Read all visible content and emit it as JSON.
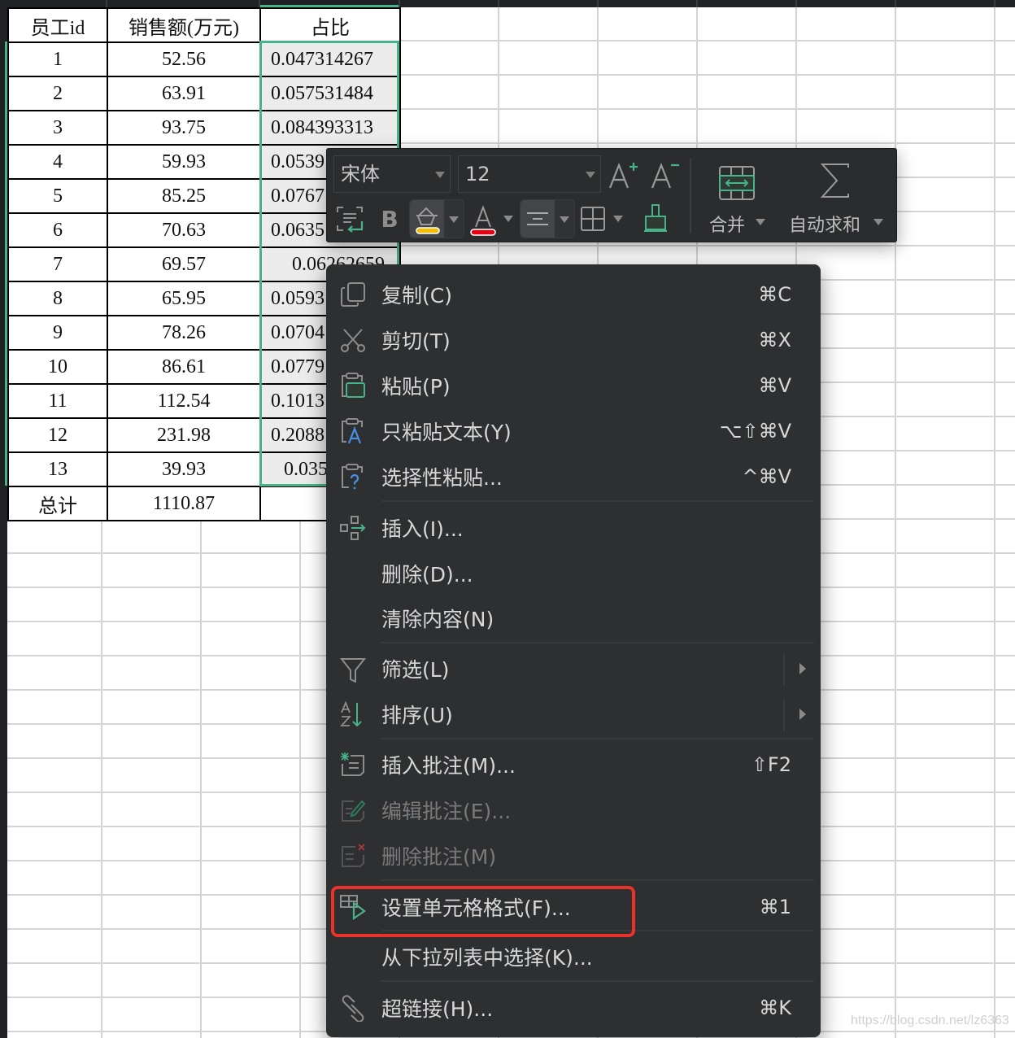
{
  "sheet": {
    "headers": [
      "员工id",
      "销售额(万元)",
      "占比"
    ],
    "rows": [
      {
        "id": "1",
        "sales": "52.56",
        "ratio": "0.047314267"
      },
      {
        "id": "2",
        "sales": "63.91",
        "ratio": "0.057531484"
      },
      {
        "id": "3",
        "sales": "93.75",
        "ratio": "0.084393313"
      },
      {
        "id": "4",
        "sales": "59.93",
        "ratio": "0.0539"
      },
      {
        "id": "5",
        "sales": "85.25",
        "ratio": "0.0767"
      },
      {
        "id": "6",
        "sales": "70.63",
        "ratio": "0.0635"
      },
      {
        "id": "7",
        "sales": "69.57",
        "ratio": "0.06262659"
      },
      {
        "id": "8",
        "sales": "65.95",
        "ratio": "0.0593"
      },
      {
        "id": "9",
        "sales": "78.26",
        "ratio": "0.0704"
      },
      {
        "id": "10",
        "sales": "86.61",
        "ratio": "0.0779"
      },
      {
        "id": "11",
        "sales": "112.54",
        "ratio": "0.1013"
      },
      {
        "id": "12",
        "sales": "231.98",
        "ratio": "0.2088"
      },
      {
        "id": "13",
        "sales": "39.93",
        "ratio": "0.035"
      }
    ],
    "total": {
      "label": "总计",
      "sales": "1110.87",
      "ratio": ""
    }
  },
  "toolbar": {
    "font_name": "宋体",
    "font_size": "12",
    "increase_font_icon": "font-increase-icon",
    "decrease_font_icon": "font-decrease-icon",
    "bold_label": "B",
    "fill_color": "#f5bd00",
    "font_color": "#e60012",
    "merge_label": "合并",
    "autosum_label": "自动求和",
    "sigma": "∑",
    "accent": "#46b38a"
  },
  "context_menu": {
    "items": [
      {
        "label": "复制(C)",
        "shortcut": "⌘C",
        "icon": "copy-icon",
        "enabled": true
      },
      {
        "label": "剪切(T)",
        "shortcut": "⌘X",
        "icon": "scissors-icon",
        "enabled": true
      },
      {
        "label": "粘贴(P)",
        "shortcut": "⌘V",
        "icon": "paste-icon",
        "enabled": true
      },
      {
        "label": "只粘贴文本(Y)",
        "shortcut": "⌥⇧⌘V",
        "icon": "paste-text-icon",
        "enabled": true
      },
      {
        "label": "选择性粘贴...",
        "shortcut": "^⌘V",
        "icon": "paste-special-icon",
        "enabled": true
      },
      {
        "label": "插入(I)...",
        "shortcut": "",
        "icon": "insert-icon",
        "enabled": true
      },
      {
        "label": "删除(D)...",
        "shortcut": "",
        "icon": "",
        "enabled": true
      },
      {
        "label": "清除内容(N)",
        "shortcut": "",
        "icon": "",
        "enabled": true
      },
      {
        "label": "筛选(L)",
        "shortcut": "",
        "icon": "filter-icon",
        "enabled": true,
        "submenu": true
      },
      {
        "label": "排序(U)",
        "shortcut": "",
        "icon": "sort-icon",
        "enabled": true,
        "submenu": true
      },
      {
        "label": "插入批注(M)...",
        "shortcut": "⇧F2",
        "icon": "insert-comment-icon",
        "enabled": true
      },
      {
        "label": "编辑批注(E)...",
        "shortcut": "",
        "icon": "edit-comment-icon",
        "enabled": false
      },
      {
        "label": "删除批注(M)",
        "shortcut": "",
        "icon": "delete-comment-icon",
        "enabled": false
      },
      {
        "label": "设置单元格格式(F)...",
        "shortcut": "⌘1",
        "icon": "format-cells-icon",
        "enabled": true,
        "highlighted": true
      },
      {
        "label": "从下拉列表中选择(K)...",
        "shortcut": "",
        "icon": "",
        "enabled": true
      },
      {
        "label": "超链接(H)...",
        "shortcut": "⌘K",
        "icon": "link-icon",
        "enabled": true
      }
    ],
    "highlight_color": "#e8322a"
  },
  "watermark": "https://blog.csdn.net/lz6363"
}
